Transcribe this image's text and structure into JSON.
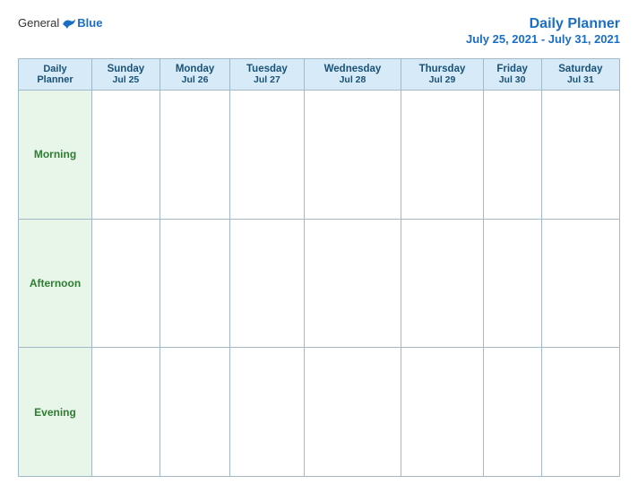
{
  "header": {
    "logo": {
      "general": "General",
      "blue": "Blue",
      "bird_alt": "blue bird logo"
    },
    "title": "Daily Planner",
    "subtitle": "July 25, 2021 - July 31, 2021"
  },
  "table": {
    "planner_label": "Daily\nPlanner",
    "columns": [
      {
        "day": "Sunday",
        "date": "Jul 25"
      },
      {
        "day": "Monday",
        "date": "Jul 26"
      },
      {
        "day": "Tuesday",
        "date": "Jul 27"
      },
      {
        "day": "Wednesday",
        "date": "Jul 28"
      },
      {
        "day": "Thursday",
        "date": "Jul 29"
      },
      {
        "day": "Friday",
        "date": "Jul 30"
      },
      {
        "day": "Saturday",
        "date": "Jul 31"
      }
    ],
    "rows": [
      {
        "label": "Morning"
      },
      {
        "label": "Afternoon"
      },
      {
        "label": "Evening"
      }
    ]
  }
}
